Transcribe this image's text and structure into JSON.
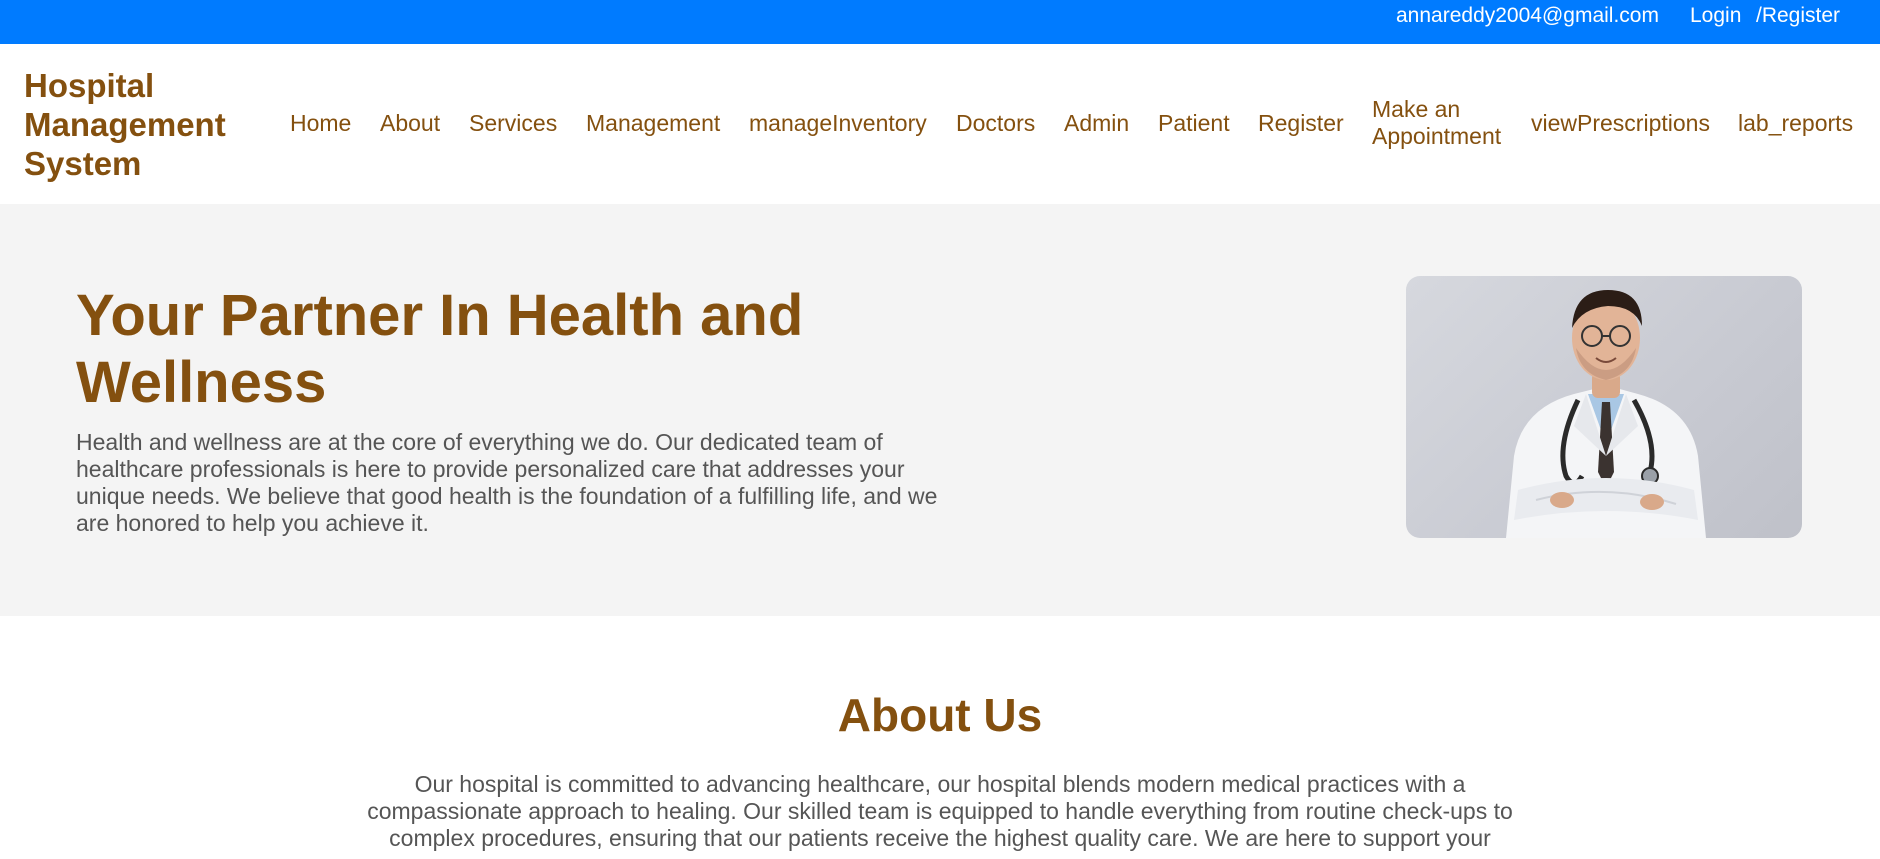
{
  "topbar": {
    "email": "annareddy2004@gmail.com",
    "login_label": "Login",
    "register_label": "/Register",
    "background": "#007bff"
  },
  "navbar": {
    "brand": "Hospital Management System",
    "links": [
      "Home",
      "About",
      "Services",
      "Management",
      "manageInventory",
      "Doctors",
      "Admin",
      "Patient",
      "Register",
      "Make an Appointment",
      "viewPrescriptions",
      "lab_reports"
    ],
    "link_color": "#84500f"
  },
  "hero": {
    "title": "Your Partner In Health and Wellness",
    "text": "Health and wellness are at the core of everything we do. Our dedicated team of healthcare professionals is here to provide personalized care that addresses your unique needs. We believe that good health is the foundation of a fulfilling life, and we are honored to help you achieve it.",
    "image_icon": "doctor-photo",
    "background": "#f4f4f4"
  },
  "about": {
    "title": "About Us",
    "text": "Our hospital is committed to advancing healthcare, our hospital blends modern medical practices with a compassionate approach to healing. Our skilled team is equipped to handle everything from routine check-ups to complex procedures, ensuring that our patients receive the highest quality care. We are here to support your"
  }
}
